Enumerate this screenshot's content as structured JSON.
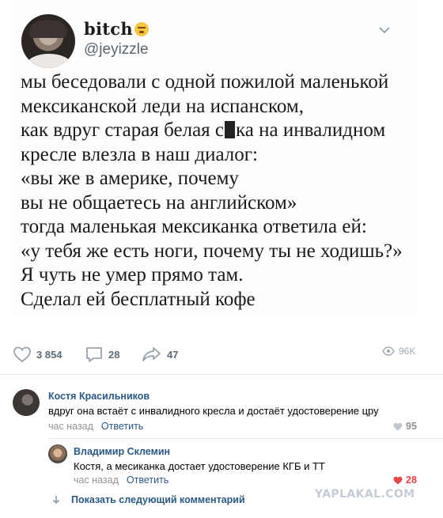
{
  "tweet": {
    "display_name": "bitch",
    "emoji": "tired-face-emoji",
    "handle": "@jeyizzle",
    "lines": [
      "мы беседовали с одной пожилой маленькой",
      "мексиканской леди на испанском,",
      "как вдруг старая белая с",
      "ка на инвалидном",
      "кресле влезла в наш диалог:",
      "«вы же в америке, почему",
      "вы не общаетесь на английском»",
      "тогда маленькая  мексиканка ответила ей:",
      "«у тебя же есть ноги, почему ты не ходишь?»",
      "Я чуть не умер прямо там.",
      "Сделал ей бесплатный кофе"
    ]
  },
  "actions": {
    "likes": "3 854",
    "comments": "28",
    "shares": "47",
    "views": "96K"
  },
  "comments": [
    {
      "author": "Костя Красильников",
      "text": "вдруг она встаёт с инвалидного кресла и достаёт удостоверение цру",
      "time": "час назад",
      "reply": "Ответить",
      "likes": "95"
    },
    {
      "author": "Владимир Склемин",
      "text": "Костя, а месиканка достает удостоверение КГБ и ТТ",
      "time": "час назад",
      "reply": "Ответить",
      "likes": "28"
    }
  ],
  "more_comments": "Показать следующий комментарий",
  "watermark": "YAPLAKAL.COM",
  "colors": {
    "link": "#2a5885",
    "muted": "#939393",
    "like_active": "#e64646",
    "action_icon": "#99a2ad"
  }
}
